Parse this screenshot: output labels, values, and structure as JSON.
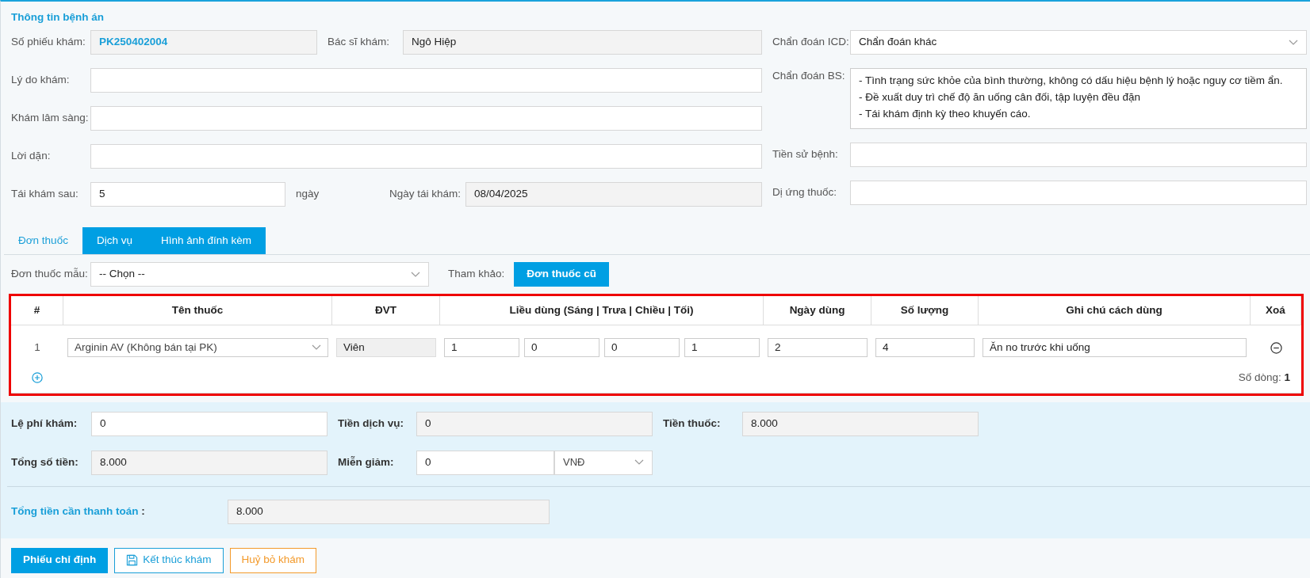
{
  "section_title": "Thông tin bệnh án",
  "fields": {
    "ticket": {
      "label": "Số phiếu khám:",
      "value": "PK250402004",
      "readonly": true
    },
    "doctor": {
      "label": "Bác sĩ khám:",
      "value": "Ngô Hiệp",
      "readonly": true
    },
    "icd": {
      "label": "Chẩn đoán ICD:",
      "value": "Chẩn đoán khác",
      "readonly": false
    },
    "reason": {
      "label": "Lý do khám:",
      "readonly": false
    },
    "clinical": {
      "label": "Khám lâm sàng:",
      "readonly": false
    },
    "diagnosis": {
      "label": "Chẩn đoán BS:",
      "lines": [
        "- Tình trạng sức khỏe của bình thường, không có dấu hiệu bệnh lý hoặc nguy cơ tiềm ẩn.",
        "- Đề xuất duy trì chế độ ăn uống cân đối, tập luyện đều đặn",
        "- Tái khám định kỳ theo khuyến cáo."
      ],
      "readonly": false
    },
    "advice": {
      "label": "Lời dặn:",
      "readonly": false
    },
    "history": {
      "label": "Tiền sử bệnh:",
      "readonly": false
    },
    "followup": {
      "label": "Tái khám sau:",
      "value": "5",
      "unit": "ngày",
      "readonly": false
    },
    "followup_date": {
      "label": "Ngày tái khám:",
      "value": "08/04/2025",
      "readonly": true
    },
    "allergy": {
      "label": "Dị ứng thuốc:",
      "readonly": false
    }
  },
  "tabs": [
    {
      "label": "Đơn thuốc",
      "selected": true
    },
    {
      "label": "Dịch vụ",
      "selected": false
    },
    {
      "label": "Hình ảnh đính kèm",
      "selected": false
    }
  ],
  "template": {
    "label": "Đơn thuốc mẫu:",
    "value": "-- Chọn --"
  },
  "reference": {
    "label": "Tham khảo:",
    "button": "Đơn thuốc cũ"
  },
  "table": {
    "columns": [
      "#",
      "Tên thuốc",
      "ĐVT",
      "Liều dùng (Sáng | Trưa | Chiều | Tối)",
      "Ngày dùng",
      "Số lượng",
      "Ghi chú cách dùng",
      "Xoá"
    ],
    "rows": [
      {
        "index": "1",
        "drug": "Arginin AV (Không bán tại PK)",
        "unit": "Viên",
        "doses": [
          "1",
          "0",
          "0",
          "1"
        ],
        "days": "2",
        "quantity": "4",
        "note": "Ăn no trước khi uống"
      }
    ],
    "row_count_label": "Số dòng:",
    "row_count": "1"
  },
  "fees": {
    "exam_fee": {
      "label": "Lệ phí khám:",
      "value": "0",
      "readonly": false
    },
    "service": {
      "label": "Tiền dịch vụ:",
      "value": "0",
      "readonly": true
    },
    "drugs": {
      "label": "Tiền thuốc:",
      "value": "8.000",
      "readonly": true
    },
    "total": {
      "label": "Tổng số tiền:",
      "value": "8.000",
      "readonly": true
    },
    "discount": {
      "label": "Miễn giảm:",
      "value": "0",
      "currency": "VNĐ",
      "readonly": false
    },
    "payable": {
      "label": "Tổng tiền cần thanh toán",
      "colon": ":",
      "value": "8.000",
      "readonly": true
    }
  },
  "buttons": [
    {
      "label": "Phiếu chỉ định",
      "kind": "primary"
    },
    {
      "label": "Kết thúc khám",
      "kind": "save"
    },
    {
      "label": "Huỷ bỏ khám",
      "kind": "warning"
    }
  ]
}
